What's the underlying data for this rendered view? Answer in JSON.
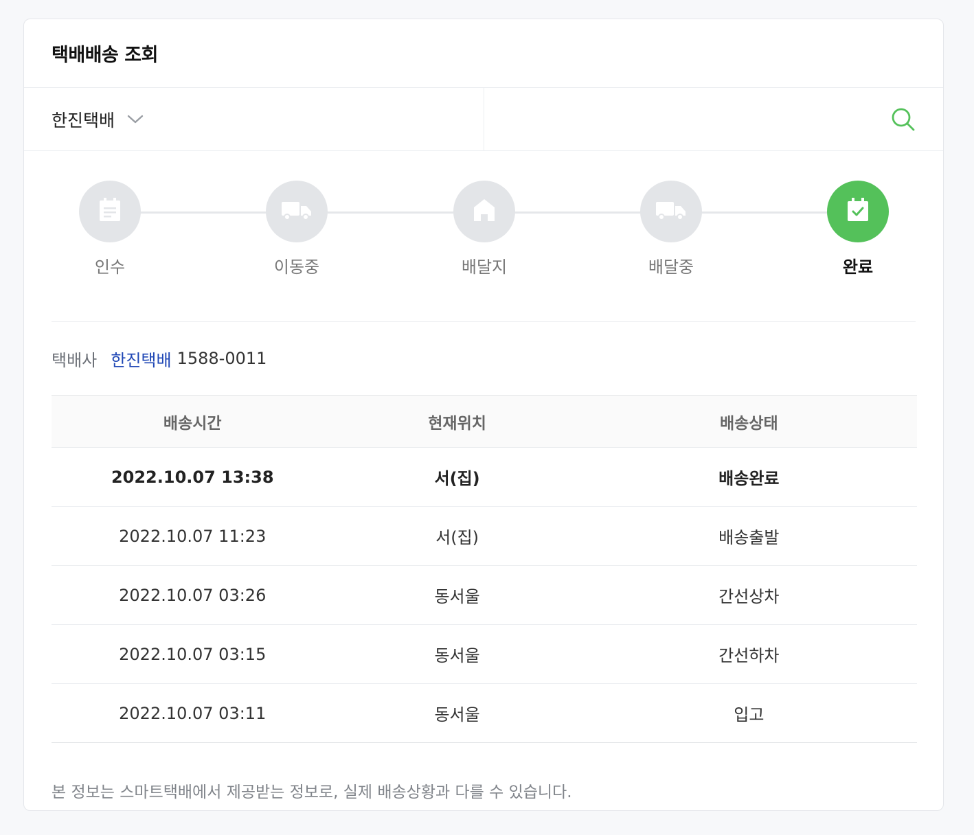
{
  "header": {
    "title": "택배배송 조회"
  },
  "search": {
    "carrier_selected": "한진택배",
    "tracking_value": "",
    "placeholder": ""
  },
  "steps": [
    {
      "label": "인수",
      "icon": "receipt-icon",
      "active": false
    },
    {
      "label": "이동중",
      "icon": "truck-icon",
      "active": false
    },
    {
      "label": "배달지",
      "icon": "house-icon",
      "active": false
    },
    {
      "label": "배달중",
      "icon": "truck-icon",
      "active": false
    },
    {
      "label": "완료",
      "icon": "calendar-check-icon",
      "active": true
    }
  ],
  "company": {
    "label": "택배사",
    "name": "한진택배",
    "phone": "1588-0011"
  },
  "table": {
    "headers": [
      "배송시간",
      "현재위치",
      "배송상태"
    ],
    "rows": [
      {
        "time": "2022.10.07 13:38",
        "location": "서(집)",
        "status": "배송완료"
      },
      {
        "time": "2022.10.07 11:23",
        "location": "서(집)",
        "status": "배송출발"
      },
      {
        "time": "2022.10.07 03:26",
        "location": "동서울",
        "status": "간선상차"
      },
      {
        "time": "2022.10.07 03:15",
        "location": "동서울",
        "status": "간선하차"
      },
      {
        "time": "2022.10.07 03:11",
        "location": "동서울",
        "status": "입고"
      }
    ]
  },
  "notice": "본 정보는 스마트택배에서 제공받는 정보로, 실제 배송상황과 다를 수 있습니다.",
  "colors": {
    "accent_green": "#54c15a",
    "link_blue": "#1f47b5",
    "inactive_step": "#e3e5e8"
  }
}
